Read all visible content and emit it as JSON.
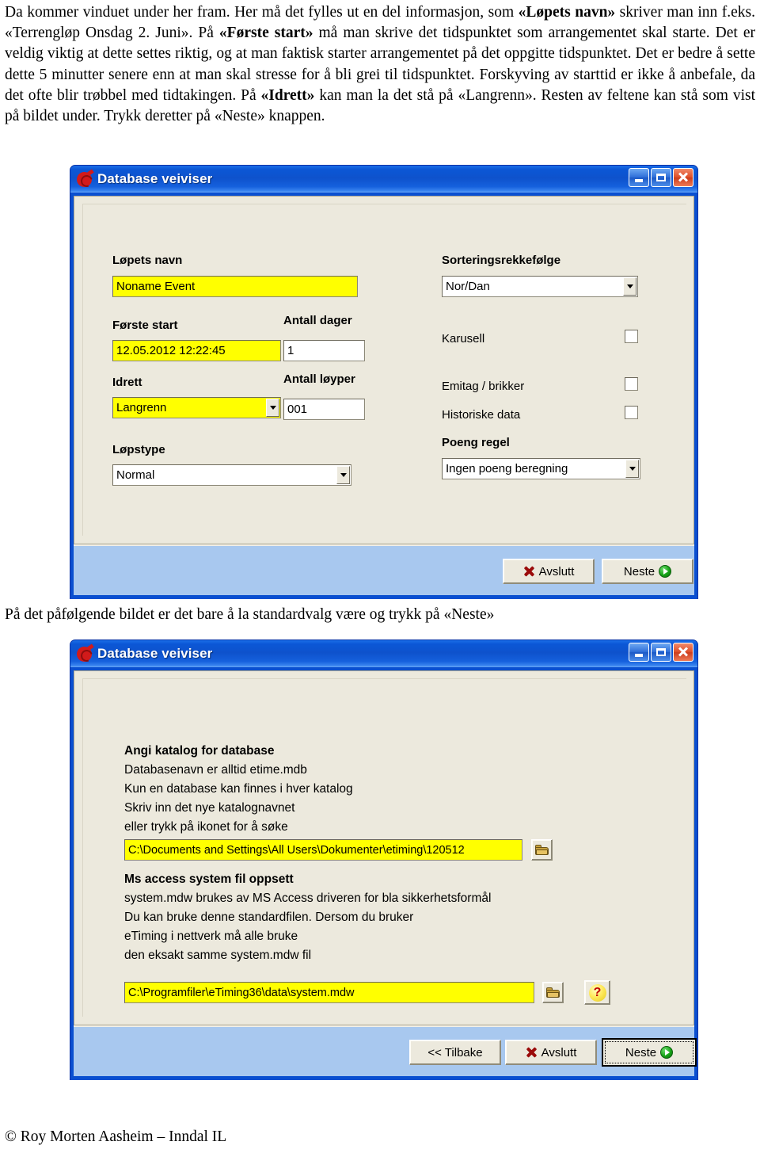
{
  "document": {
    "intro_paragraph_runs": [
      {
        "t": "Da kommer vinduet under her fram. Her må det fylles ut en del informasjon, som ",
        "b": false
      },
      {
        "t": "«Løpets navn»",
        "b": true
      },
      {
        "t": " skriver man inn f.eks. «Terrengløp Onsdag 2. Juni». På ",
        "b": false
      },
      {
        "t": "«Første start»",
        "b": true
      },
      {
        "t": " må man skrive det tidspunktet som arrangementet skal starte. Det er veldig viktig at dette settes riktig, og at man faktisk starter arrangementet på det oppgitte tidspunktet. Det er bedre å sette dette 5 minutter senere enn at man skal stresse for å bli grei til tidspunktet. Forskyving av starttid er ikke å anbefale, da det ofte blir trøbbel med tidtakingen. På ",
        "b": false
      },
      {
        "t": "«Idrett»",
        "b": true
      },
      {
        "t": " kan man la det stå på «Langrenn». Resten av feltene kan stå som vist på bildet under. Trykk deretter på «Neste» knappen.",
        "b": false
      }
    ],
    "middle_paragraph": "På det påfølgende bildet er det bare å la standardvalg være og trykk på «Neste»",
    "footer": "© Roy Morten Aasheim – Inndal IL"
  },
  "dialog1": {
    "title": "Database veiviser",
    "icon": "etiming-stopwatch-icon",
    "titlebar_buttons": {
      "minimize": "minimize-icon",
      "maximize": "maximize-icon",
      "close": "close-icon"
    },
    "fields": {
      "lopets_navn_label": "Løpets navn",
      "lopets_navn_value": "Noname Event",
      "forste_start_label": "Første start",
      "forste_start_value": "12.05.2012 12:22:45",
      "antall_dager_label": "Antall dager",
      "antall_dager_value": "1",
      "idrett_label": "Idrett",
      "idrett_value": "Langrenn",
      "antall_loyper_label": "Antall løyper",
      "antall_loyper_value": "001",
      "lopstype_label": "Løpstype",
      "lopstype_value": "Normal",
      "sortering_label": "Sorteringsrekkefølge",
      "sortering_value": "Nor/Dan",
      "karusell_label": "Karusell",
      "emitag_label": "Emitag / brikker",
      "historiske_label": "Historiske data",
      "poeng_regel_label": "Poeng regel",
      "poeng_regel_value": "Ingen poeng beregning"
    },
    "buttons": {
      "avslutt": "Avslutt",
      "neste": "Neste"
    }
  },
  "dialog2": {
    "title": "Database veiviser",
    "icon": "etiming-stopwatch-icon",
    "titlebar_buttons": {
      "minimize": "minimize-icon",
      "maximize": "maximize-icon",
      "close": "close-icon"
    },
    "section1": {
      "heading": "Angi katalog for database",
      "lines": [
        "Databasenavn er alltid etime.mdb",
        "Kun en database kan finnes i hver katalog",
        "Skriv inn det nye katalognavnet",
        "eller trykk på ikonet for å søke"
      ],
      "path_value": "C:\\Documents and Settings\\All Users\\Dokumenter\\etiming\\120512",
      "browse_icon": "folder-open-icon"
    },
    "section2": {
      "heading": "Ms access system fil oppsett",
      "lines": [
        "system.mdw brukes av MS Access driveren for bla sikkerhetsformål",
        "Du kan bruke denne standardfilen. Dersom du bruker",
        "eTiming  i nettverk må alle bruke",
        "den eksakt samme system.mdw fil"
      ],
      "path_value": "C:\\Programfiler\\eTiming36\\data\\system.mdw",
      "browse_icon": "folder-open-icon",
      "help_icon": "?"
    },
    "buttons": {
      "tilbake": "<< Tilbake",
      "avslutt": "Avslutt",
      "neste": "Neste"
    }
  },
  "colors": {
    "titlebar_blue": "#0b57d6",
    "window_border": "#0a4fd0",
    "client_bg": "#ece9dd",
    "buttonbar_bg": "#a8c8ef",
    "highlight_yellow": "#ffff00",
    "close_red": "#e0502a",
    "x_icon_red": "#9b0b0b",
    "play_green": "#17a317"
  }
}
